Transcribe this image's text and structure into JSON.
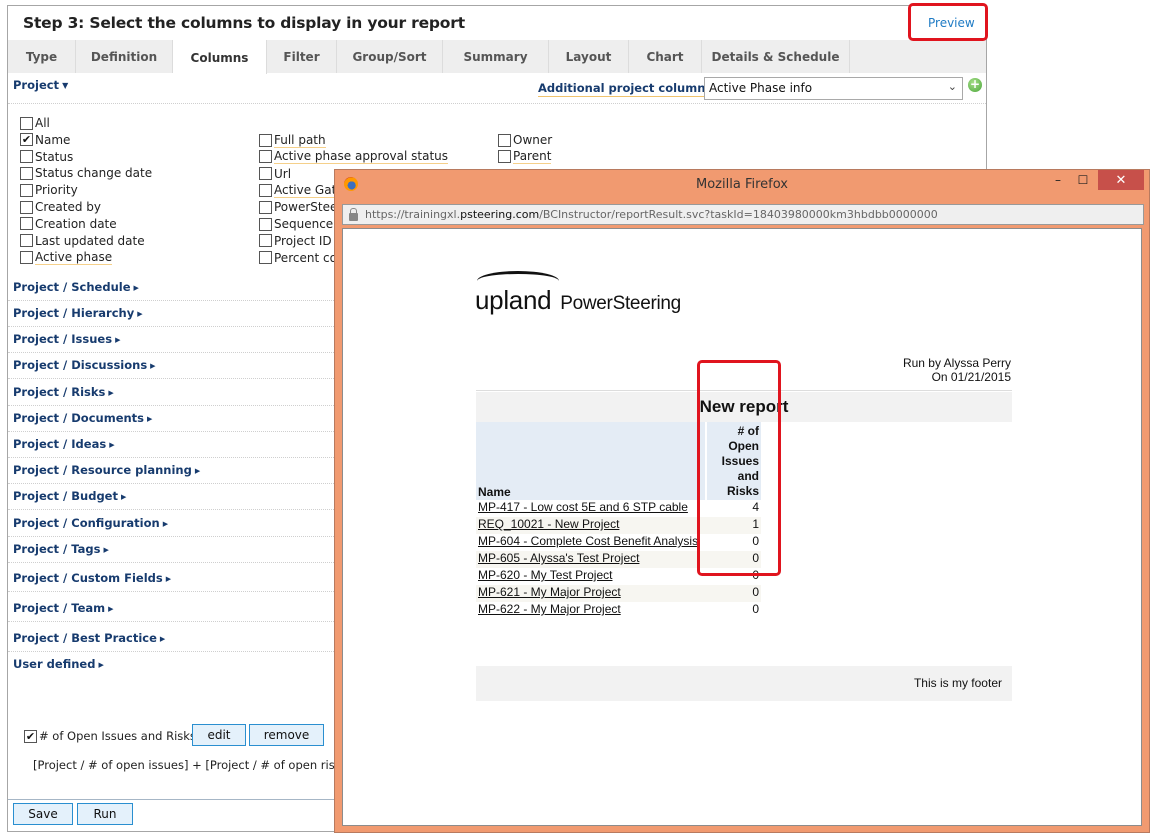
{
  "wizard": {
    "title": "Step 3: Select the columns to display in your report",
    "preview_label": "Preview",
    "tabs": [
      {
        "label": "Type",
        "active": false
      },
      {
        "label": "Definition",
        "active": false
      },
      {
        "label": "Columns",
        "active": true
      },
      {
        "label": "Filter",
        "active": false
      },
      {
        "label": "Group/Sort",
        "active": false
      },
      {
        "label": "Summary",
        "active": false
      },
      {
        "label": "Layout",
        "active": false
      },
      {
        "label": "Chart",
        "active": false
      },
      {
        "label": "Details & Schedule",
        "active": false
      }
    ]
  },
  "columns": {
    "project_header": "Project",
    "additional_label": "Additional project columns :",
    "additional_value": "Active Phase info",
    "checkboxes_col1": [
      {
        "label": "All",
        "checked": false,
        "underlined": false
      },
      {
        "label": "Name",
        "checked": true,
        "underlined": false
      },
      {
        "label": "Status",
        "checked": false,
        "underlined": false
      },
      {
        "label": "Status change date",
        "checked": false,
        "underlined": false
      },
      {
        "label": "Priority",
        "checked": false,
        "underlined": false
      },
      {
        "label": "Created by",
        "checked": false,
        "underlined": false
      },
      {
        "label": "Creation date",
        "checked": false,
        "underlined": false
      },
      {
        "label": "Last updated date",
        "checked": false,
        "underlined": false
      },
      {
        "label": "Active phase",
        "checked": false,
        "underlined": true
      }
    ],
    "checkboxes_col2": [
      {
        "label": "Full path",
        "checked": false,
        "underlined": true
      },
      {
        "label": "Active phase approval status",
        "checked": false,
        "underlined": true
      },
      {
        "label": "Url",
        "checked": false,
        "underlined": false
      },
      {
        "label": "Active Gate",
        "checked": false,
        "underlined": true
      },
      {
        "label": "PowerStee",
        "checked": false,
        "underlined": false
      },
      {
        "label": "Sequence r",
        "checked": false,
        "underlined": false
      },
      {
        "label": "Project ID",
        "checked": false,
        "underlined": false
      },
      {
        "label": "Percent co",
        "checked": false,
        "underlined": false
      }
    ],
    "checkboxes_col3": [
      {
        "label": "Owner",
        "checked": false,
        "underlined": false
      },
      {
        "label": "Parent",
        "checked": false,
        "underlined": true
      }
    ],
    "sections": [
      "Project / Schedule",
      "Project / Hierarchy",
      "Project / Issues",
      "Project / Discussions",
      "Project / Risks",
      "Project / Documents",
      "Project / Ideas",
      "Project / Resource planning",
      "Project / Budget",
      "Project / Configuration",
      "Project / Tags",
      "Project / Custom Fields",
      "Project / Team",
      "Project / Best Practice",
      "User defined"
    ],
    "custom_column": {
      "label": "# of Open Issues and Risks",
      "checked": true,
      "edit_label": "edit",
      "remove_label": "remove",
      "formula": "[Project / # of open issues] + [Project / # of open risks]"
    },
    "save_label": "Save",
    "run_label": "Run"
  },
  "browser": {
    "title": "Mozilla Firefox",
    "url_prefix": "https://trainingxl.",
    "url_domain": "psteering.com",
    "url_path": "/BCInstructor/reportResult.svc?taskId=18403980000km3hbdbb0000000",
    "minimize": "–",
    "maximize": "☐",
    "close": "✕"
  },
  "report": {
    "logo_main": "upland",
    "logo_sub": "PowerSteering",
    "run_by": "Run by Alyssa Perry",
    "run_on": "On 01/21/2015",
    "title": "New report",
    "col_name": "Name",
    "col_count": [
      "# of",
      "Open",
      "Issues",
      "and",
      "Risks"
    ],
    "rows": [
      {
        "name": "MP-417 - Low cost 5E and 6 STP cable",
        "count": "4"
      },
      {
        "name": "REQ_10021 - New Project",
        "count": "1"
      },
      {
        "name": "MP-604 - Complete Cost Benefit Analysis",
        "count": "0"
      },
      {
        "name": "MP-605 - Alyssa's Test Project",
        "count": "0"
      },
      {
        "name": "MP-620 - My Test Project",
        "count": "0"
      },
      {
        "name": "MP-621 - My Major Project",
        "count": "0"
      },
      {
        "name": "MP-622 - My Major Project",
        "count": "0"
      }
    ],
    "footer": "This is my footer"
  },
  "colors": {
    "highlight": "#e0141e",
    "link_navy": "#173b6e",
    "firefox_frame": "#f19a70",
    "button_border": "#2a8fd0"
  }
}
